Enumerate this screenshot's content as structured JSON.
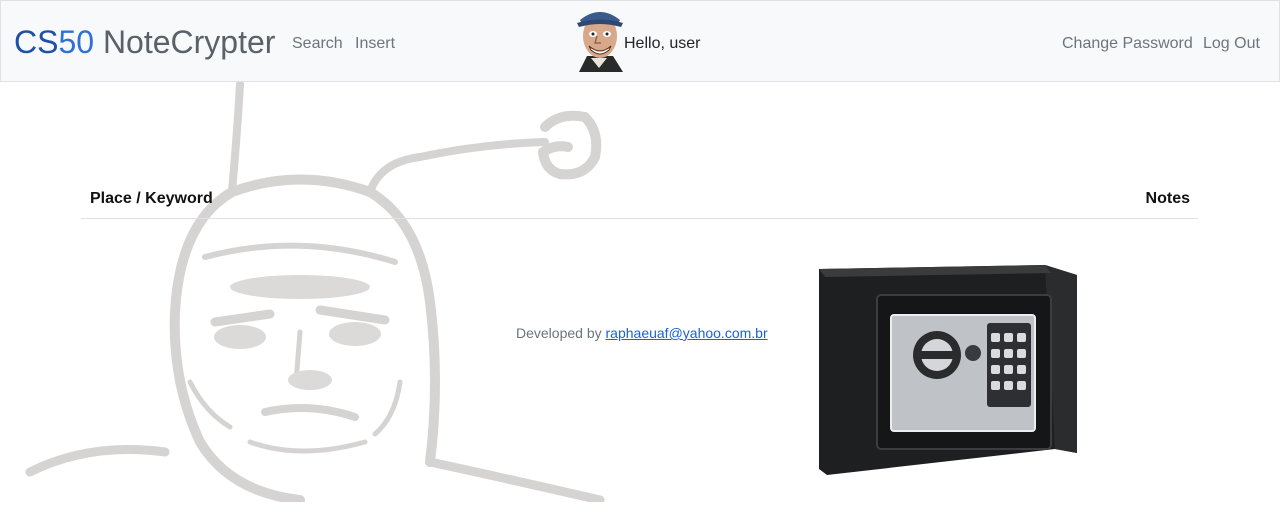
{
  "navbar": {
    "brand": {
      "cs": "CS",
      "fifty": "50",
      "name": "NoteCrypter"
    },
    "links": {
      "search": "Search",
      "insert": "Insert"
    },
    "greeting": "Hello, user",
    "right_links": {
      "change_password": "Change Password",
      "logout": "Log Out"
    }
  },
  "table": {
    "headers": {
      "place": "Place / Keyword",
      "notes": "Notes"
    },
    "rows": []
  },
  "footer": {
    "developed_by": "Developed by",
    "email": "raphaeuaf@yahoo.com.br"
  },
  "colors": {
    "navbar_bg": "#f8f9fa",
    "brand_blue": "#2f6fd6",
    "link_gray": "#6c757d",
    "link_blue": "#1a62d6"
  }
}
